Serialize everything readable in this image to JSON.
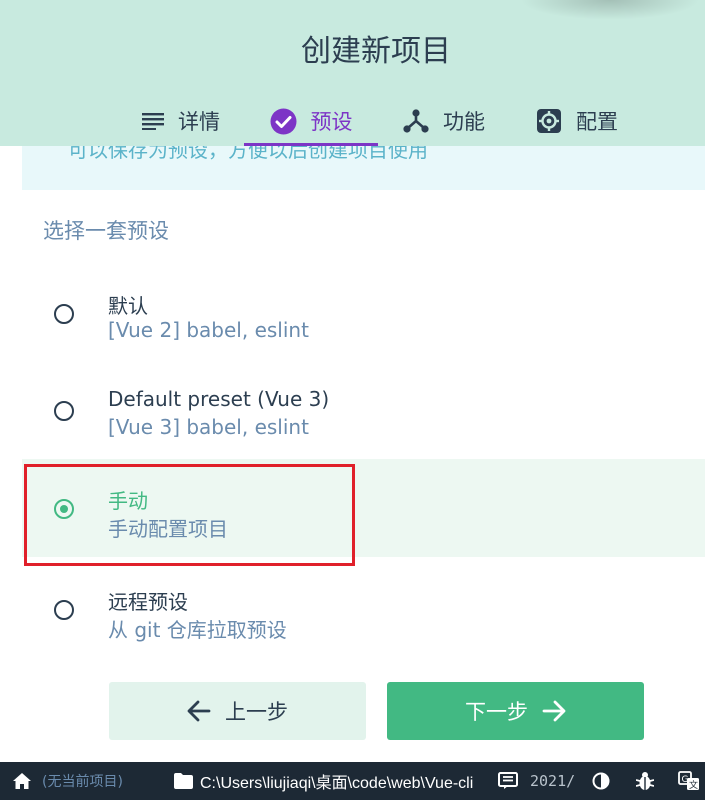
{
  "header": {
    "title": "创建新项目",
    "tabs": [
      {
        "label": "详情",
        "icon": "list-icon"
      },
      {
        "label": "预设",
        "icon": "check-circle-icon"
      },
      {
        "label": "功能",
        "icon": "fork-icon"
      },
      {
        "label": "配置",
        "icon": "gear-icon"
      }
    ],
    "active_tab": "预设"
  },
  "info_strip": {
    "text": "可以保存为预设，方便以后创建项目使用"
  },
  "section_label": "选择一套预设",
  "presets": [
    {
      "name": "默认",
      "description": "[Vue 2] babel, eslint",
      "selected": false
    },
    {
      "name": "Default preset (Vue 3)",
      "description": "[Vue 3] babel, eslint",
      "selected": false
    },
    {
      "name": "手动",
      "description": "手动配置项目",
      "selected": true
    },
    {
      "name": "远程预设",
      "description": "从 git 仓库拉取预设",
      "selected": false
    }
  ],
  "buttons": {
    "prev": "上一步",
    "next": "下一步"
  },
  "statusbar": {
    "project": "(无当前项目)",
    "path": "C:\\Users\\liujiaqi\\桌面\\code\\web\\Vue-cli",
    "time": "2021/"
  },
  "colors": {
    "header_bg": "#c8eadf",
    "accent_purple": "#7d35c6",
    "accent_green": "#42b983",
    "highlight_red": "#e0202a",
    "statusbar_bg": "#1d2935"
  }
}
